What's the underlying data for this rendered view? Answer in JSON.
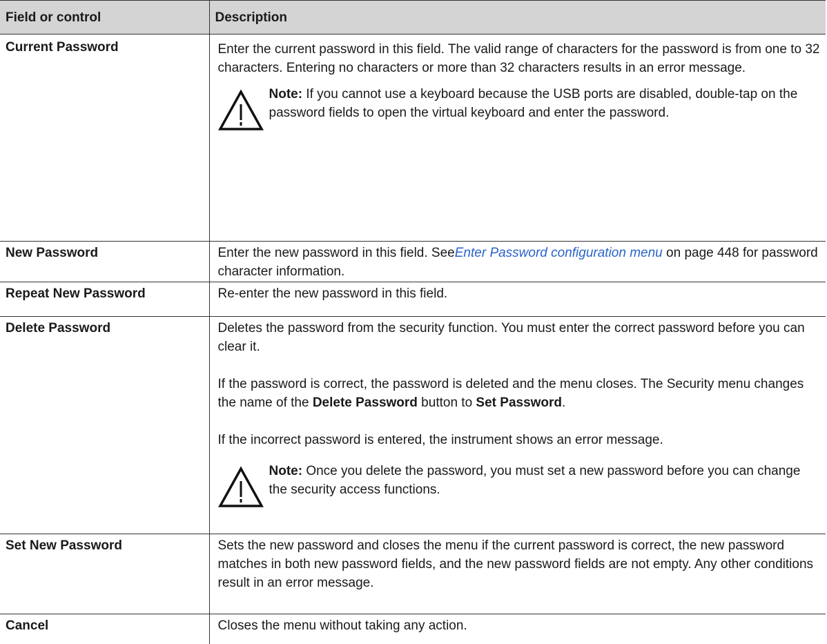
{
  "table": {
    "headers": {
      "field": "Field or control",
      "description": "Description"
    },
    "rows": {
      "current_password": {
        "field": "Current Password",
        "text": "Enter the current password in this field. The valid range of characters for the password is from one to 32 characters. Entering no characters or more than 32 characters results in an error message.",
        "note_label": "Note:",
        "note_text": " If you cannot use a keyboard because the USB ports are disabled, double-tap on the password fields to open the virtual keyboard and enter the password."
      },
      "new_password": {
        "field": "New Password",
        "text_before": "Enter the new password in this field. See",
        "link": "Enter Password configuration menu",
        "text_after": " on page 448 for password character information."
      },
      "repeat_new_password": {
        "field": "Repeat New Password",
        "text": "Re-enter the new password in this field."
      },
      "delete_password": {
        "field": "Delete Password",
        "para1": "Deletes the password from the security function. You must enter the correct password before you can clear it.",
        "para2_a": "If the password is correct, the password is deleted and the menu closes. The Security menu changes the name of the ",
        "para2_b": "Delete Password",
        "para2_c": " button to ",
        "para2_d": "Set Password",
        "para2_e": ".",
        "para3": "If the incorrect password is entered, the instrument shows an error message.",
        "note_label": "Note:",
        "note_text": " Once you delete the password, you must set a new password before you can change the security access functions."
      },
      "set_new_password": {
        "field": "Set New Password",
        "text": "Sets the new password and closes the menu if the current password is correct, the new password matches in both new password fields, and the new password fields are not empty. Any other conditions result in an error message."
      },
      "cancel": {
        "field": "Cancel",
        "text": "Closes the menu without taking any action."
      }
    }
  },
  "icons": {
    "note": "warning-triangle-icon"
  }
}
